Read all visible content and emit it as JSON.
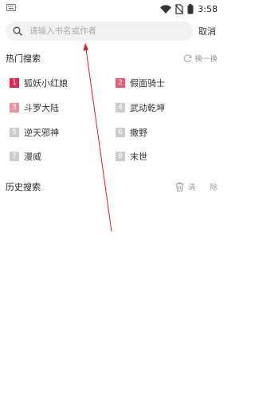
{
  "status_bar": {
    "time": "3:58"
  },
  "search": {
    "placeholder": "请输入书名或作者",
    "value": "",
    "cancel_label": "取消"
  },
  "hot": {
    "title": "热门搜索",
    "swap_label": "换一换",
    "items": [
      {
        "rank": "1",
        "term": "狐妖小红娘",
        "badge_color": "#e6254a"
      },
      {
        "rank": "2",
        "term": "假面骑士",
        "badge_color": "#ee5b70"
      },
      {
        "rank": "3",
        "term": "斗罗大陆",
        "badge_color": "#f2909d"
      },
      {
        "rank": "4",
        "term": "武动乾坤",
        "badge_color": "#cccccc"
      },
      {
        "rank": "5",
        "term": "逆天邪神",
        "badge_color": "#cccccc"
      },
      {
        "rank": "6",
        "term": "撒野",
        "badge_color": "#cccccc"
      },
      {
        "rank": "7",
        "term": "漫威",
        "badge_color": "#cccccc"
      },
      {
        "rank": "8",
        "term": "末世",
        "badge_color": "#cccccc"
      }
    ]
  },
  "history": {
    "title": "历史搜索",
    "clear_label_1": "清",
    "clear_label_2": "除"
  },
  "colors": {
    "accent": "#e6254a",
    "annotation_arrow": "#e31b23"
  }
}
